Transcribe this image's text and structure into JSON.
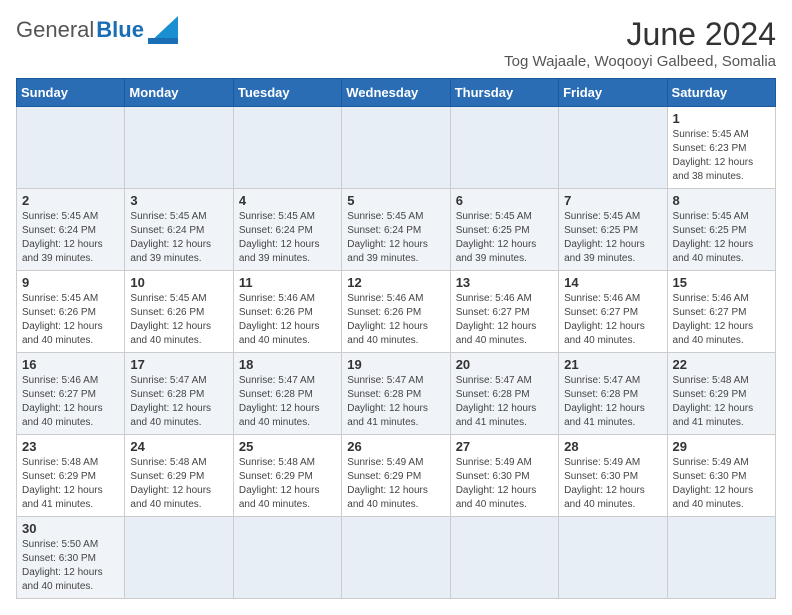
{
  "header": {
    "logo_general": "General",
    "logo_blue": "Blue",
    "title": "June 2024",
    "subtitle": "Tog Wajaale, Woqooyi Galbeed, Somalia"
  },
  "days_of_week": [
    "Sunday",
    "Monday",
    "Tuesday",
    "Wednesday",
    "Thursday",
    "Friday",
    "Saturday"
  ],
  "weeks": [
    [
      {
        "day": "",
        "info": ""
      },
      {
        "day": "",
        "info": ""
      },
      {
        "day": "",
        "info": ""
      },
      {
        "day": "",
        "info": ""
      },
      {
        "day": "",
        "info": ""
      },
      {
        "day": "",
        "info": ""
      },
      {
        "day": "1",
        "info": "Sunrise: 5:45 AM\nSunset: 6:23 PM\nDaylight: 12 hours\nand 38 minutes."
      }
    ],
    [
      {
        "day": "2",
        "info": "Sunrise: 5:45 AM\nSunset: 6:24 PM\nDaylight: 12 hours\nand 39 minutes."
      },
      {
        "day": "3",
        "info": "Sunrise: 5:45 AM\nSunset: 6:24 PM\nDaylight: 12 hours\nand 39 minutes."
      },
      {
        "day": "4",
        "info": "Sunrise: 5:45 AM\nSunset: 6:24 PM\nDaylight: 12 hours\nand 39 minutes."
      },
      {
        "day": "5",
        "info": "Sunrise: 5:45 AM\nSunset: 6:24 PM\nDaylight: 12 hours\nand 39 minutes."
      },
      {
        "day": "6",
        "info": "Sunrise: 5:45 AM\nSunset: 6:25 PM\nDaylight: 12 hours\nand 39 minutes."
      },
      {
        "day": "7",
        "info": "Sunrise: 5:45 AM\nSunset: 6:25 PM\nDaylight: 12 hours\nand 39 minutes."
      },
      {
        "day": "8",
        "info": "Sunrise: 5:45 AM\nSunset: 6:25 PM\nDaylight: 12 hours\nand 40 minutes."
      }
    ],
    [
      {
        "day": "9",
        "info": "Sunrise: 5:45 AM\nSunset: 6:26 PM\nDaylight: 12 hours\nand 40 minutes."
      },
      {
        "day": "10",
        "info": "Sunrise: 5:45 AM\nSunset: 6:26 PM\nDaylight: 12 hours\nand 40 minutes."
      },
      {
        "day": "11",
        "info": "Sunrise: 5:46 AM\nSunset: 6:26 PM\nDaylight: 12 hours\nand 40 minutes."
      },
      {
        "day": "12",
        "info": "Sunrise: 5:46 AM\nSunset: 6:26 PM\nDaylight: 12 hours\nand 40 minutes."
      },
      {
        "day": "13",
        "info": "Sunrise: 5:46 AM\nSunset: 6:27 PM\nDaylight: 12 hours\nand 40 minutes."
      },
      {
        "day": "14",
        "info": "Sunrise: 5:46 AM\nSunset: 6:27 PM\nDaylight: 12 hours\nand 40 minutes."
      },
      {
        "day": "15",
        "info": "Sunrise: 5:46 AM\nSunset: 6:27 PM\nDaylight: 12 hours\nand 40 minutes."
      }
    ],
    [
      {
        "day": "16",
        "info": "Sunrise: 5:46 AM\nSunset: 6:27 PM\nDaylight: 12 hours\nand 40 minutes."
      },
      {
        "day": "17",
        "info": "Sunrise: 5:47 AM\nSunset: 6:28 PM\nDaylight: 12 hours\nand 40 minutes."
      },
      {
        "day": "18",
        "info": "Sunrise: 5:47 AM\nSunset: 6:28 PM\nDaylight: 12 hours\nand 40 minutes."
      },
      {
        "day": "19",
        "info": "Sunrise: 5:47 AM\nSunset: 6:28 PM\nDaylight: 12 hours\nand 41 minutes."
      },
      {
        "day": "20",
        "info": "Sunrise: 5:47 AM\nSunset: 6:28 PM\nDaylight: 12 hours\nand 41 minutes."
      },
      {
        "day": "21",
        "info": "Sunrise: 5:47 AM\nSunset: 6:28 PM\nDaylight: 12 hours\nand 41 minutes."
      },
      {
        "day": "22",
        "info": "Sunrise: 5:48 AM\nSunset: 6:29 PM\nDaylight: 12 hours\nand 41 minutes."
      }
    ],
    [
      {
        "day": "23",
        "info": "Sunrise: 5:48 AM\nSunset: 6:29 PM\nDaylight: 12 hours\nand 41 minutes."
      },
      {
        "day": "24",
        "info": "Sunrise: 5:48 AM\nSunset: 6:29 PM\nDaylight: 12 hours\nand 40 minutes."
      },
      {
        "day": "25",
        "info": "Sunrise: 5:48 AM\nSunset: 6:29 PM\nDaylight: 12 hours\nand 40 minutes."
      },
      {
        "day": "26",
        "info": "Sunrise: 5:49 AM\nSunset: 6:29 PM\nDaylight: 12 hours\nand 40 minutes."
      },
      {
        "day": "27",
        "info": "Sunrise: 5:49 AM\nSunset: 6:30 PM\nDaylight: 12 hours\nand 40 minutes."
      },
      {
        "day": "28",
        "info": "Sunrise: 5:49 AM\nSunset: 6:30 PM\nDaylight: 12 hours\nand 40 minutes."
      },
      {
        "day": "29",
        "info": "Sunrise: 5:49 AM\nSunset: 6:30 PM\nDaylight: 12 hours\nand 40 minutes."
      }
    ],
    [
      {
        "day": "30",
        "info": "Sunrise: 5:50 AM\nSunset: 6:30 PM\nDaylight: 12 hours\nand 40 minutes."
      },
      {
        "day": "",
        "info": ""
      },
      {
        "day": "",
        "info": ""
      },
      {
        "day": "",
        "info": ""
      },
      {
        "day": "",
        "info": ""
      },
      {
        "day": "",
        "info": ""
      },
      {
        "day": "",
        "info": ""
      }
    ]
  ]
}
